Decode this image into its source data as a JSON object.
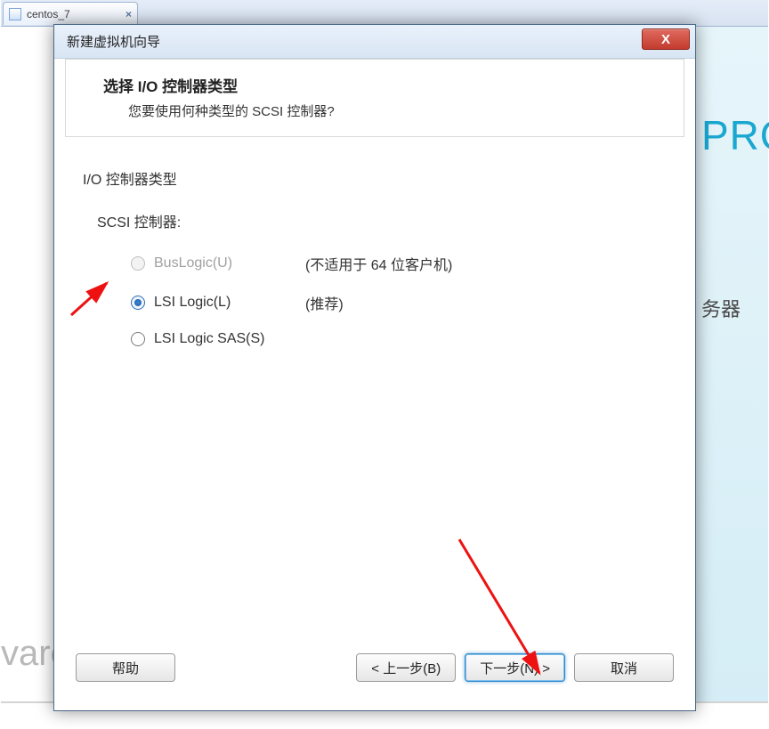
{
  "tab": {
    "label": "centos_7"
  },
  "background": {
    "brand_fragment_right": "PRO",
    "brand_fragment_bottom": "vare",
    "cn_fragment": "务器"
  },
  "dialog": {
    "title": "新建虚拟机向导",
    "close_glyph": "X",
    "header_title": "选择 I/O 控制器类型",
    "header_subtitle": "您要使用何种类型的 SCSI 控制器?",
    "group_label": "I/O 控制器类型",
    "scsi_label": "SCSI 控制器:",
    "options": [
      {
        "label": "BusLogic(U)",
        "note": "(不适用于 64 位客户机)",
        "enabled": false,
        "checked": false
      },
      {
        "label": "LSI Logic(L)",
        "note": "(推荐)",
        "enabled": true,
        "checked": true
      },
      {
        "label": "LSI Logic SAS(S)",
        "note": "",
        "enabled": true,
        "checked": false
      }
    ],
    "buttons": {
      "help": "帮助",
      "back": "< 上一步(B)",
      "next": "下一步(N) >",
      "cancel": "取消"
    }
  }
}
